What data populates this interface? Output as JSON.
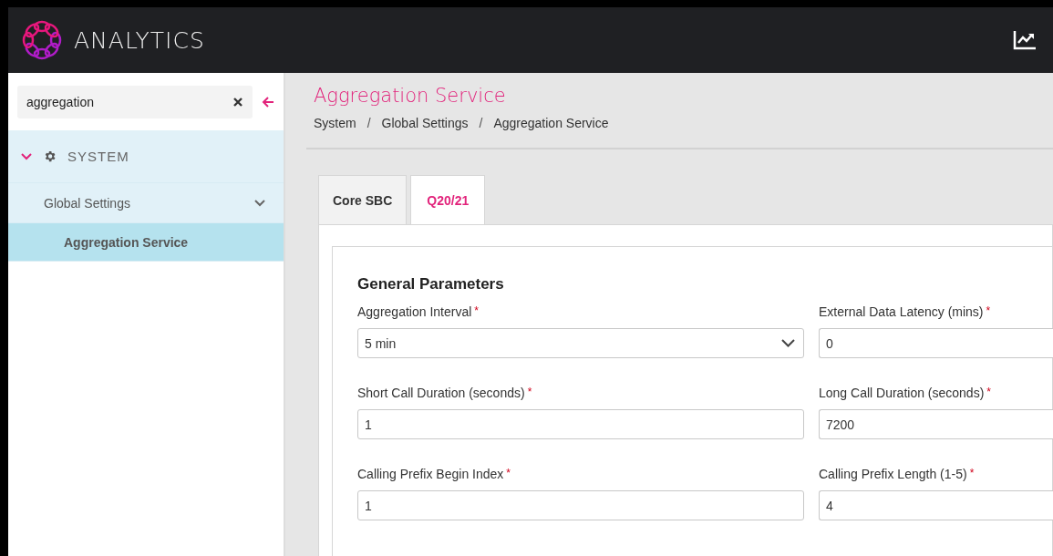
{
  "header": {
    "title": "ANALYTICS"
  },
  "sidebar": {
    "search": {
      "value": "aggregation"
    },
    "tree": [
      {
        "label": "SYSTEM",
        "expanded": true,
        "selected": false,
        "children": [
          {
            "label": "Global Settings",
            "expanded": true,
            "selected": false,
            "children": [
              {
                "label": "Aggregation Service",
                "selected": true
              }
            ]
          }
        ]
      }
    ]
  },
  "page": {
    "title": "Aggregation Service",
    "breadcrumbs": [
      "System",
      "Global Settings",
      "Aggregation Service"
    ],
    "breadcrumb_separator": "/",
    "tabs": [
      {
        "label": "Core SBC",
        "selected": false
      },
      {
        "label": "Q20/21",
        "selected": true
      }
    ],
    "section": {
      "title": "General Parameters",
      "fields": [
        {
          "kind": "select",
          "label": "Aggregation Interval",
          "required_mark": "*",
          "value": "5 min"
        },
        {
          "kind": "input",
          "label": "External Data Latency (mins)",
          "required_mark": "*",
          "value": "0"
        },
        {
          "kind": "input",
          "label": "Short Call Duration (seconds)",
          "required_mark": "*",
          "value": "1"
        },
        {
          "kind": "input",
          "label": "Long Call Duration (seconds)",
          "required_mark": "*",
          "value": "7200"
        },
        {
          "kind": "input",
          "label": "Calling Prefix Begin Index",
          "required_mark": "*",
          "value": "1"
        },
        {
          "kind": "input",
          "label": "Calling Prefix Length (1-5)",
          "required_mark": "*",
          "value": "4"
        }
      ]
    }
  }
}
